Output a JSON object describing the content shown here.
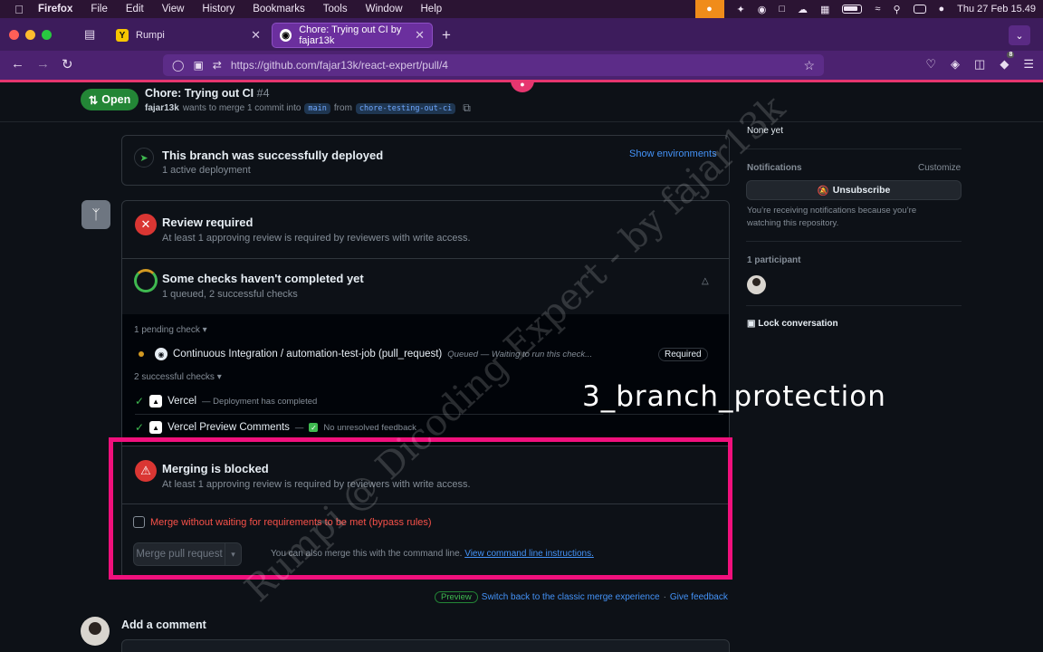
{
  "menubar": {
    "apple_icon": "apple-icon",
    "app": "Firefox",
    "items": [
      "File",
      "Edit",
      "View",
      "History",
      "Bookmarks",
      "Tools",
      "Window",
      "Help"
    ],
    "clock": "Thu 27 Feb  15.49"
  },
  "tabs": [
    {
      "title": "Rumpi",
      "favicon": "Y"
    },
    {
      "title": "Chore: Trying out CI by fajar13k",
      "favicon": "gh"
    }
  ],
  "url": "https://github.com/fajar13k/react-expert/pull/4",
  "toolbar": {
    "ext_badge": "8"
  },
  "pr": {
    "state": "Open",
    "title": "Chore: Trying out CI",
    "number": "#4",
    "author": "fajar13k",
    "sub_text": "wants to merge 1 commit into",
    "base": "main",
    "from_word": "from",
    "head": "chore-testing-out-ci"
  },
  "deploy": {
    "title": "This branch was successfully deployed",
    "subtitle": "1 active deployment",
    "link": "Show environments"
  },
  "review": {
    "title": "Review required",
    "subtitle": "At least 1 approving review is required by reviewers with write access."
  },
  "checks": {
    "title": "Some checks haven't completed yet",
    "subtitle": "1 queued, 2 successful checks",
    "pending_head": "1 pending check",
    "pending": {
      "name": "Continuous Integration / automation-test-job (pull_request)",
      "meta": "Queued — Waiting to run this check...",
      "badge": "Required"
    },
    "success_head": "2 successful checks",
    "success": [
      {
        "name": "Vercel",
        "meta": "— Deployment has completed"
      },
      {
        "name": "Vercel Preview Comments",
        "meta_pre": "—",
        "meta": "No unresolved feedback"
      }
    ]
  },
  "blocked": {
    "title": "Merging is blocked",
    "subtitle": "At least 1 approving review is required by reviewers with write access.",
    "bypass": "Merge without waiting for requirements to be met (bypass rules)",
    "merge_button": "Merge pull request",
    "note": "You can also merge this with the command line.",
    "note_link": "View command line instructions."
  },
  "footer": {
    "preview_badge": "Preview",
    "switch_link": "Switch back to the classic merge experience",
    "dot": "·",
    "feedback_link": "Give feedback",
    "add_comment": "Add a comment"
  },
  "sidebar": {
    "none_yet": "None yet",
    "notifications": "Notifications",
    "customize": "Customize",
    "unsubscribe": "Unsubscribe",
    "note": "You’re receiving notifications because you’re watching this repository.",
    "participants": "1 participant",
    "lock": "Lock conversation"
  },
  "overlay": {
    "caption": "3_branch_protection",
    "watermark": "Rumpi @ Dicoding Expert - by fajar13k"
  },
  "colors": {
    "accent_pink": "#f0107c",
    "success": "#3fb950",
    "danger": "#da3633",
    "link": "#4493f8"
  }
}
